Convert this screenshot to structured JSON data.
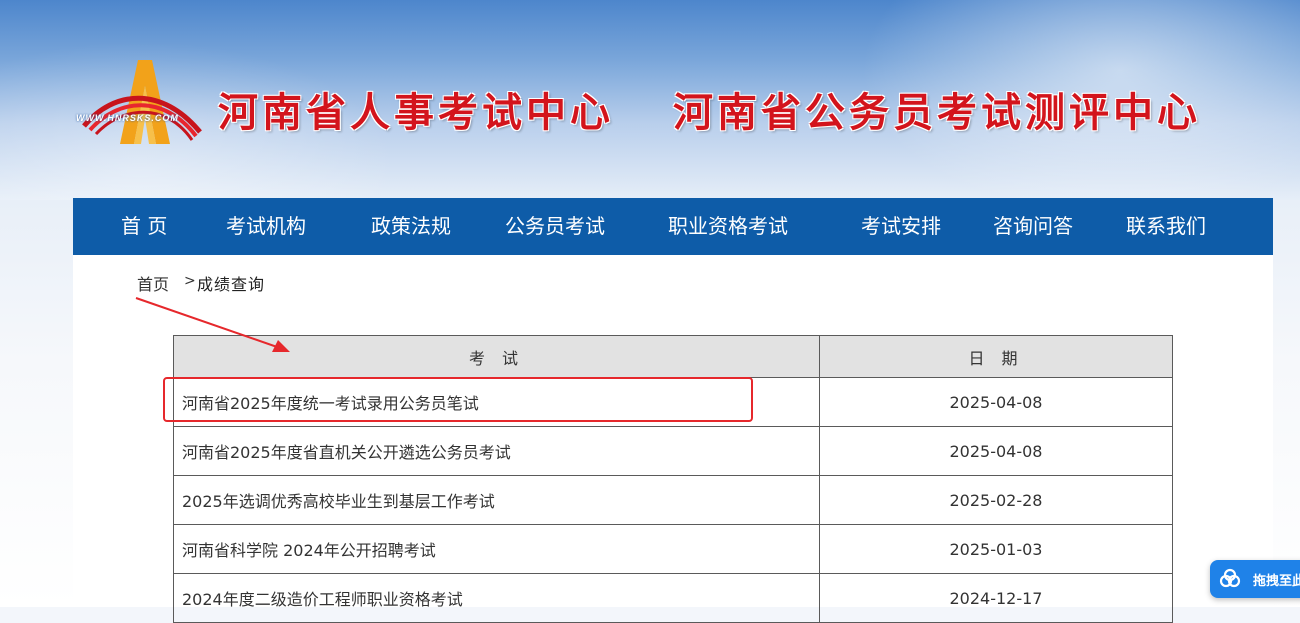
{
  "header": {
    "logo_text": "WWW.HNRSKS.COM",
    "title_left": "河南省人事考试中心",
    "title_right": "河南省公务员考试测评中心",
    "colors": {
      "title": "#d3141c",
      "nav_bg": "#0e5ca8"
    }
  },
  "nav": {
    "items": [
      {
        "label": "首 页"
      },
      {
        "label": "考试机构"
      },
      {
        "label": "政策法规"
      },
      {
        "label": "公务员考试"
      },
      {
        "label": "职业资格考试"
      },
      {
        "label": "考试安排"
      },
      {
        "label": "咨询问答"
      },
      {
        "label": "联系我们"
      }
    ]
  },
  "breadcrumb": {
    "home": "首页",
    "separator": ">",
    "current": "成绩查询"
  },
  "table": {
    "headers": {
      "exam": "考 试",
      "date": "日 期"
    },
    "rows": [
      {
        "name": "河南省2025年度统一考试录用公务员笔试",
        "date": "2025-04-08",
        "highlighted": true
      },
      {
        "name": "河南省2025年度省直机关公开遴选公务员考试",
        "date": "2025-04-08"
      },
      {
        "name": "2025年选调优秀高校毕业生到基层工作考试",
        "date": "2025-02-28"
      },
      {
        "name": "河南省科学院 2024年公开招聘考试",
        "date": "2025-01-03"
      },
      {
        "name": "2024年度二级造价工程师职业资格考试",
        "date": "2024-12-17"
      }
    ]
  },
  "annotation": {
    "color": "#e6282c"
  },
  "float_widget": {
    "label": "拖拽至此",
    "icon": "cloud-icon"
  }
}
